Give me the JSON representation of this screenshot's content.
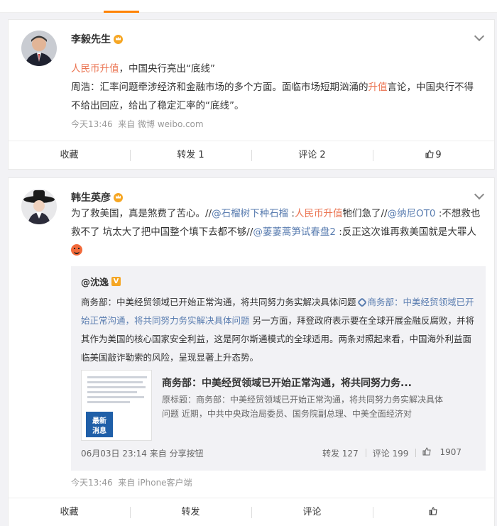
{
  "colors": {
    "accent": "#ff8200",
    "link": "#eb7350",
    "mention": "#5a7db0"
  },
  "post1": {
    "author": "李毅先生",
    "headline_link": "人民币升值",
    "headline_rest": "，中国央行亮出“底线”",
    "body_a": "周浩：汇率问题牵涉经济和金融市场的多个方面。面临市场短期汹涌的",
    "body_link": "升值",
    "body_b": "言论，中国央行不得不给出回应，给出了稳定汇率的“底线”。",
    "time": "今天13:46",
    "source": "来自 微博 weibo.com",
    "actions": {
      "fav": "收藏",
      "repost": "转发 1",
      "comment": "评论 2",
      "like": "9"
    }
  },
  "post2": {
    "author": "韩生英彦",
    "t1": "为了救美国，真是煞费了苦心。//",
    "m1": "@石榴树下种石榴",
    "t2": " :",
    "l1": "人民币升值",
    "t3": "牠们急了//",
    "m2": "@纳尼OT0",
    "t4": " :不想救也救不了 坑太大了把中国整个填下去都不够//",
    "m3": "@萋萋蒿笋试春盘2",
    "t5": " :反正这次谁再救美国就是大罪人",
    "time": "今天13:46",
    "source": "来自 iPhone客户端",
    "actions": {
      "fav": "收藏",
      "repost": "转发",
      "comment": "评论",
      "like": ""
    },
    "repost": {
      "author": "@沈逸",
      "badge": "V",
      "r1": "商务部：中美经贸领域已开始正常沟通，将共同努力务实解决具体问题 ",
      "rlink": "商务部：中美经贸领域已开始正常沟通，将共同努力务实解决具体问题",
      "r2": " 另一方面，拜登政府表示要在全球开展金融反腐败，并将其作为美国的核心国家安全利益，这是阿尔斯通模式的全球适用。两条对照起来看，中国海外利益面临美国敲诈勒索的风险，呈现显著上升态势。",
      "article_title": "商务部：中美经贸领域已开始正常沟通，将共同努力务...",
      "article_desc": "原标题：商务部：中美经贸领域已开始正常沟通，将共同努力务实解决具体问题 近期，中共中央政治局委员、国务院副总理、中美全面经济对",
      "thumb_label": "最新消息",
      "meta": "06月03日 23:14 来自 分享按钮",
      "repost_count": "转发 127",
      "comment_count": "评论 199",
      "like_count": "1907"
    }
  }
}
